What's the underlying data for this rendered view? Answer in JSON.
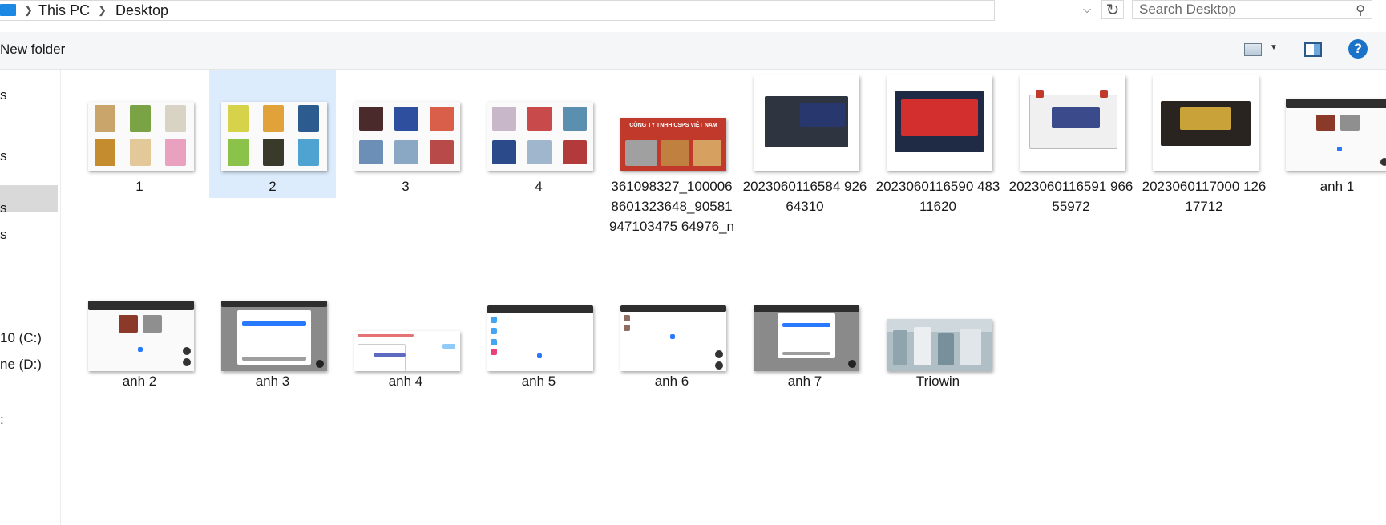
{
  "address_bar": {
    "crumbs": [
      "This PC",
      "Desktop"
    ],
    "search_placeholder": "Search Desktop"
  },
  "toolbar": {
    "new_folder_label": "New folder",
    "help_label": "?"
  },
  "nav": {
    "items": [
      "s",
      "s",
      "s",
      "s",
      "10 (C:)",
      "ne (D:)",
      ":"
    ]
  },
  "files": [
    {
      "name": "1",
      "selected": false
    },
    {
      "name": "2",
      "selected": true
    },
    {
      "name": "3",
      "selected": false
    },
    {
      "name": "4",
      "selected": false
    },
    {
      "name": "361098327_1000068601323648_90581947103475 64976_n",
      "selected": false,
      "thumb_text": "CÔNG TY TNHH CSPS VIỆT NAM"
    },
    {
      "name": "2023060116584 92664310",
      "selected": false
    },
    {
      "name": "2023060116590 48311620",
      "selected": false
    },
    {
      "name": "2023060116591 96655972",
      "selected": false
    },
    {
      "name": "2023060117000 12617712",
      "selected": false
    },
    {
      "name": "anh 1",
      "selected": false
    },
    {
      "name": "anh 2",
      "selected": false
    },
    {
      "name": "anh 3",
      "selected": false
    },
    {
      "name": "anh 4",
      "selected": false
    },
    {
      "name": "anh 5",
      "selected": false
    },
    {
      "name": "anh 6",
      "selected": false
    },
    {
      "name": "anh 7",
      "selected": false
    },
    {
      "name": "Triowin",
      "selected": false
    }
  ],
  "colors": {
    "selection": "#dcecfc",
    "accent": "#1a73c8",
    "nav_selection": "#d9d9d9"
  }
}
